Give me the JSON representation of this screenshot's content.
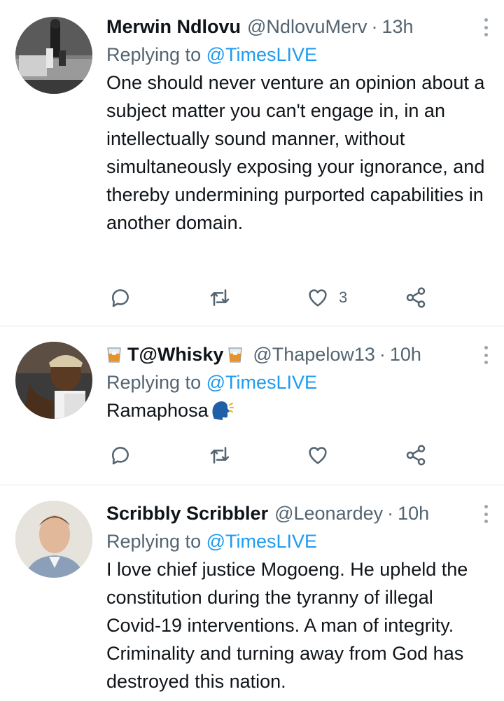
{
  "tweets": [
    {
      "name": "Merwin Ndlovu",
      "handle": "@NdlovuMerv",
      "separator": "·",
      "time": "13h",
      "replying_prefix": "Replying to",
      "replying_handle": "@TimesLIVE",
      "text": "One should never venture an opinion about a subject matter you can't engage in, in an intellectually sound manner, without simultaneously exposing your ignorance, and thereby undermining purported capabilities in another domain.",
      "like_count": "3"
    },
    {
      "name": "T@Whisky",
      "handle": "@Thapelow13",
      "separator": "·",
      "time": "10h",
      "replying_prefix": "Replying to",
      "replying_handle": "@TimesLIVE",
      "text": "Ramaphosa",
      "like_count": ""
    },
    {
      "name": "Scribbly Scribbler",
      "handle": "@Leonardey",
      "separator": "·",
      "time": "10h",
      "replying_prefix": "Replying to",
      "replying_handle": "@TimesLIVE",
      "text": "I love chief justice Mogoeng. He upheld the constitution during the tyranny of illegal Covid-19 interventions. A man of integrity. Criminality and turning away from God has destroyed this nation.",
      "like_count": ""
    }
  ],
  "icons": [
    "reply-icon",
    "retweet-icon",
    "like-icon",
    "share-icon",
    "more-icon",
    "whisky-glass-icon",
    "speaking-head-icon"
  ],
  "colors": {
    "link": "#1d9bf0",
    "secondary_text": "#536471",
    "icon": "#536471",
    "divider": "#e6e9eb"
  }
}
